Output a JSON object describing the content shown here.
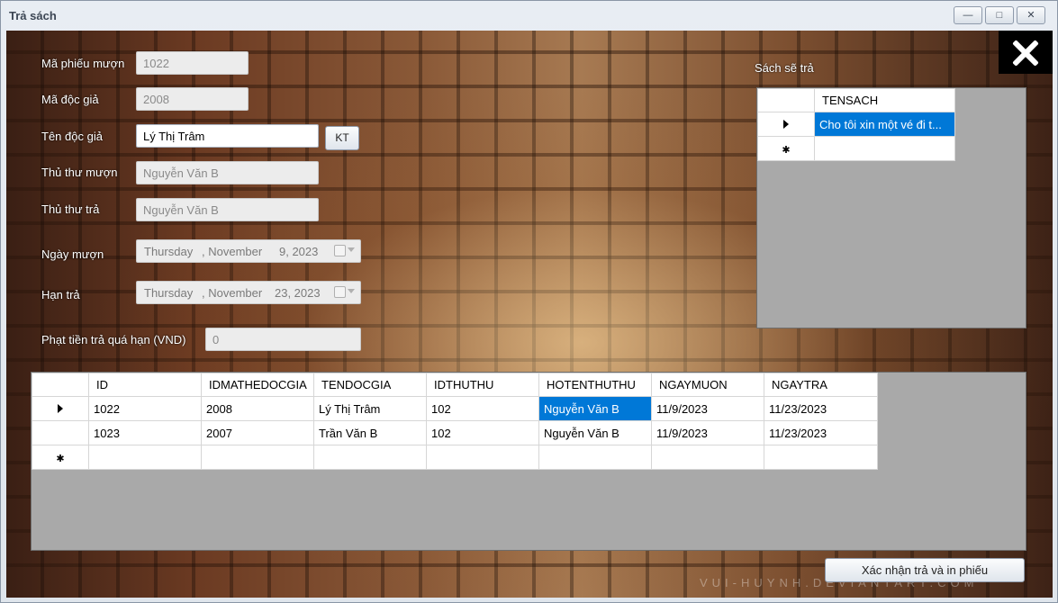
{
  "window": {
    "title": "Trả sách",
    "min_icon": "minimize-icon",
    "max_icon": "maximize-icon",
    "close_icon": "close-icon"
  },
  "form": {
    "ma_phieu_muon": {
      "label": "Mã phiếu mượn",
      "value": "1022"
    },
    "ma_doc_gia": {
      "label": "Mã độc giả",
      "value": "2008"
    },
    "ten_doc_gia": {
      "label": "Tên độc giả",
      "value": "Lý Thị Trâm"
    },
    "kt_button": "KT",
    "thu_thu_muon": {
      "label": "Thủ thư mượn",
      "value": "Nguyễn Văn B"
    },
    "thu_thu_tra": {
      "label": "Thủ thư trả",
      "value": "Nguyễn Văn B"
    },
    "ngay_muon": {
      "label": "Ngày mượn",
      "weekday": "Thursday",
      "month": ", November",
      "day_year": "9, 2023"
    },
    "han_tra": {
      "label": "Hạn trả",
      "weekday": "Thursday",
      "month": ", November",
      "day_year": "23, 2023"
    },
    "phat_tien": {
      "label": "Phạt tiền trả quá hạn (VND)",
      "value": "0"
    }
  },
  "books_panel": {
    "label": "Sách sẽ trả",
    "column": "TENSACH",
    "rows": [
      {
        "tensach": "Cho tôi xin một vé đi t..."
      }
    ]
  },
  "loans_grid": {
    "columns": [
      "ID",
      "IDMATHEDOCGIA",
      "TENDOCGIA",
      "IDTHUTHU",
      "HOTENTHUTHU",
      "NGAYMUON",
      "NGAYTRA"
    ],
    "rows": [
      [
        "1022",
        "2008",
        "Lý Thị Trâm",
        "102",
        "Nguyễn Văn B",
        "11/9/2023",
        "11/23/2023"
      ],
      [
        "1023",
        "2007",
        "Trần Văn B",
        "102",
        "Nguyễn Văn B",
        "11/9/2023",
        "11/23/2023"
      ]
    ]
  },
  "confirm_button": "Xác nhận trả và in phiếu",
  "watermark": "VUI-HUYNH.DEVIANTART.COM"
}
